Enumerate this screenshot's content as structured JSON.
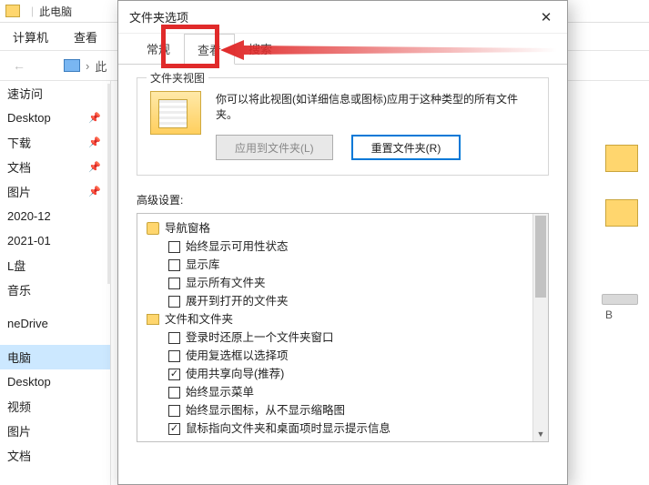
{
  "bg": {
    "title": "此电脑",
    "menu": {
      "computer": "计算机",
      "view": "查看"
    },
    "breadcrumb": "此",
    "sidebar": [
      {
        "label": "速访问",
        "pin": false
      },
      {
        "label": "Desktop",
        "pin": true
      },
      {
        "label": "下载",
        "pin": true
      },
      {
        "label": "文档",
        "pin": true
      },
      {
        "label": "图片",
        "pin": true
      },
      {
        "label": "2020-12",
        "pin": false
      },
      {
        "label": "2021-01",
        "pin": false
      },
      {
        "label": "L盘",
        "pin": false
      },
      {
        "label": "音乐",
        "pin": false
      },
      {
        "label": "neDrive",
        "pin": false,
        "spacer_before": true
      },
      {
        "label": "电脑",
        "pin": false,
        "selected": true,
        "spacer_before": true
      },
      {
        "label": "Desktop",
        "pin": false
      },
      {
        "label": "视频",
        "pin": false
      },
      {
        "label": "图片",
        "pin": false
      },
      {
        "label": "文档",
        "pin": false
      }
    ],
    "drive_letter": "B"
  },
  "dialog": {
    "title": "文件夹选项",
    "tabs": {
      "general": "常规",
      "view": "查看",
      "search": "搜索"
    },
    "group_view": {
      "legend": "文件夹视图",
      "desc": "你可以将此视图(如详细信息或图标)应用于这种类型的所有文件夹。",
      "apply_btn": "应用到文件夹(L)",
      "reset_btn": "重置文件夹(R)"
    },
    "advanced_label": "高级设置:",
    "tree": {
      "nav_pane": "导航窗格",
      "nav_children": [
        {
          "label": "始终显示可用性状态",
          "checked": false
        },
        {
          "label": "显示库",
          "checked": false
        },
        {
          "label": "显示所有文件夹",
          "checked": false
        },
        {
          "label": "展开到打开的文件夹",
          "checked": false
        }
      ],
      "files_folders": "文件和文件夹",
      "ff_children": [
        {
          "label": "登录时还原上一个文件夹窗口",
          "checked": false
        },
        {
          "label": "使用复选框以选择项",
          "checked": false
        },
        {
          "label": "使用共享向导(推荐)",
          "checked": true
        },
        {
          "label": "始终显示菜单",
          "checked": false
        },
        {
          "label": "始终显示图标，从不显示缩略图",
          "checked": false
        },
        {
          "label": "鼠标指向文件夹和桌面项时显示提示信息",
          "checked": true
        }
      ]
    }
  }
}
